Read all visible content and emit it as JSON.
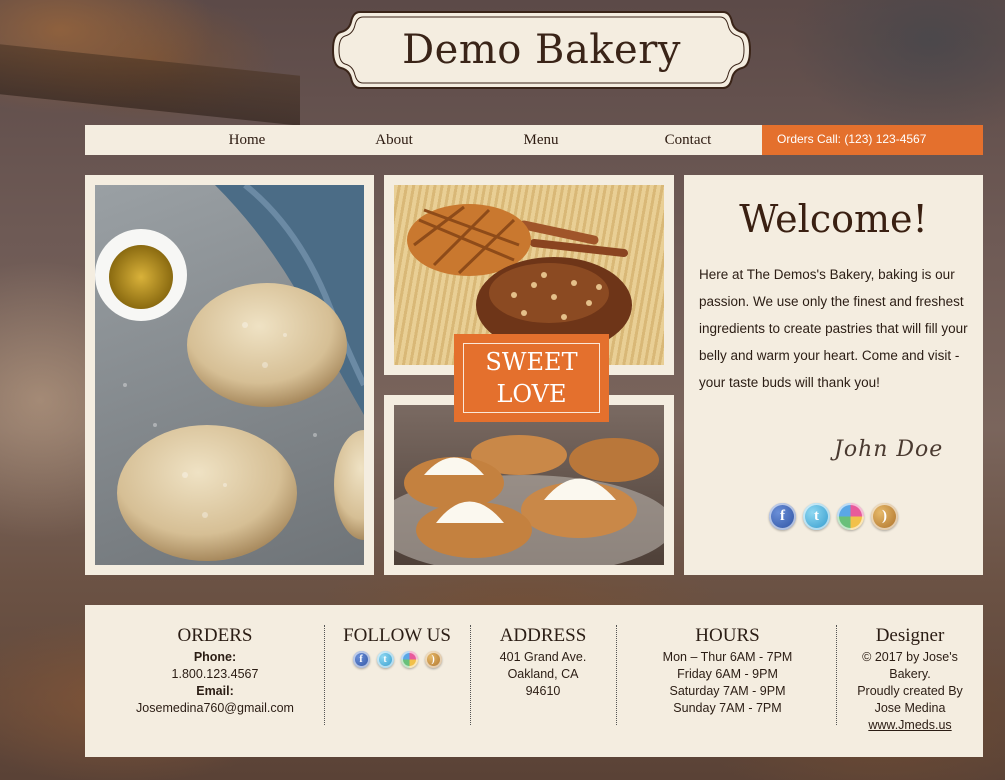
{
  "brand": {
    "title": "Demo Bakery"
  },
  "nav": {
    "items": [
      {
        "label": "Home"
      },
      {
        "label": "About"
      },
      {
        "label": "Menu"
      },
      {
        "label": "Contact"
      }
    ],
    "orders_call": "Orders Call: (123) 123-4567"
  },
  "promo": {
    "line1": "SWEET",
    "line2": "LOVE"
  },
  "welcome": {
    "title": "Welcome!",
    "text": "Here at The Demos's Bakery, baking is our passion. We use only the finest and freshest ingredients to create pastries that will fill your belly and warm your heart. Come and visit - your taste buds will thank you!",
    "signature": "John Doe"
  },
  "social": {
    "icons": [
      "facebook-icon",
      "twitter-icon",
      "flickr-icon",
      "rss-icon"
    ]
  },
  "footer": {
    "orders": {
      "heading": "ORDERS",
      "phone_label": "Phone:",
      "phone": "1.800.123.4567",
      "email_label": "Email:",
      "email": "Josemedina760@gmail.com"
    },
    "follow": {
      "heading": "FOLLOW US"
    },
    "address": {
      "heading": "ADDRESS",
      "line1": "401 Grand Ave.",
      "line2": "Oakland, CA",
      "line3": "94610"
    },
    "hours": {
      "heading": "HOURS",
      "line1": "Mon – Thur 6AM - 7PM",
      "line2": "Friday 6AM - 9PM",
      "line3": "Saturday 7AM - 9PM",
      "line4": "Sunday 7AM - 7PM"
    },
    "designer": {
      "heading": "Designer",
      "line1": "© 2017 by Jose's",
      "line2": "Bakery.",
      "line3": "Proudly created By",
      "line4": "Jose Medina",
      "link": "www.Jmeds.us"
    }
  },
  "colors": {
    "accent": "#e4702d",
    "panel": "#f4ede0",
    "text": "#2b1d14"
  }
}
